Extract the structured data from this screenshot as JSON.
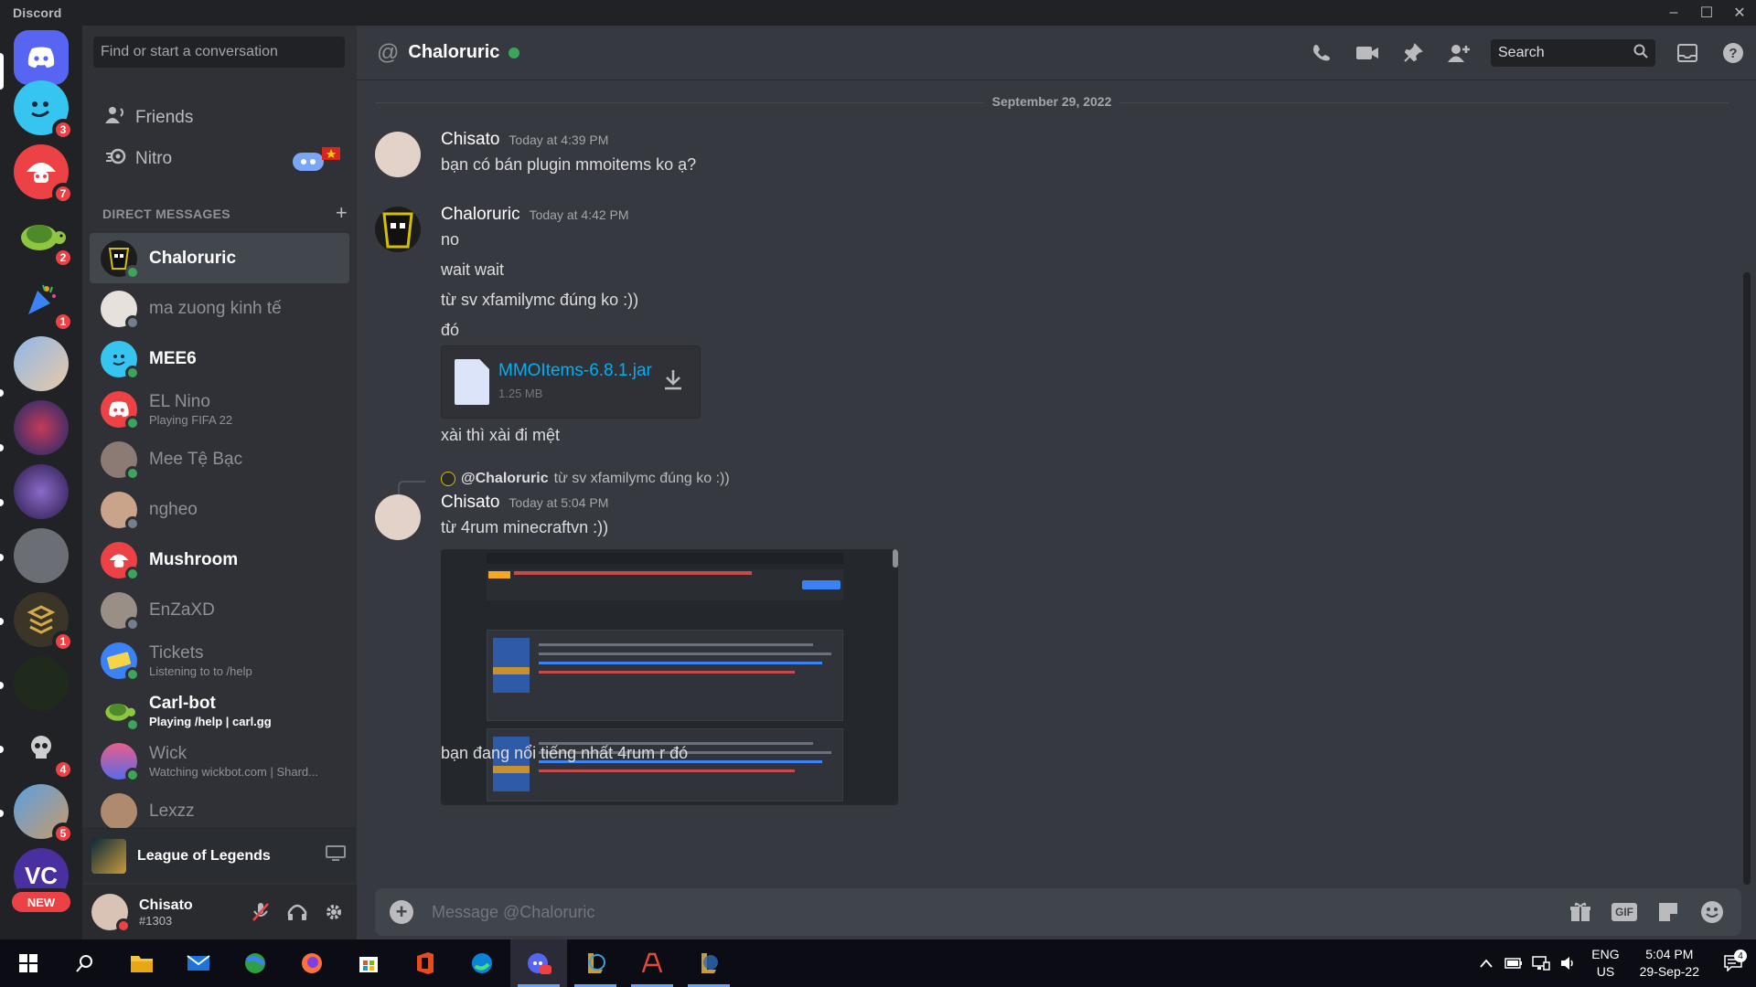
{
  "titlebar": {
    "brand": "Discord",
    "min": "–",
    "max": "☐",
    "close": "✕"
  },
  "servers": [
    {
      "name": "home",
      "badge": ""
    },
    {
      "name": "mee6-server",
      "badge": "3"
    },
    {
      "name": "mushroom-server",
      "badge": "7"
    },
    {
      "name": "turtle-server",
      "badge": "2"
    },
    {
      "name": "party-server",
      "badge": "1"
    },
    {
      "name": "anime-server",
      "badge": ""
    },
    {
      "name": "blue-server",
      "badge": ""
    },
    {
      "name": "purple-server",
      "badge": ""
    },
    {
      "name": "grey-server",
      "badge": ""
    },
    {
      "name": "gold-server",
      "badge": "1"
    },
    {
      "name": "dark-server",
      "badge": ""
    },
    {
      "name": "skull-server",
      "badge": "4"
    },
    {
      "name": "person-server",
      "badge": "5"
    },
    {
      "name": "vc-server",
      "badge": "NEW",
      "label": "VC"
    }
  ],
  "dm_panel": {
    "search_placeholder": "Find or start a conversation",
    "friends_label": "Friends",
    "nitro_label": "Nitro",
    "section_title": "DIRECT MESSAGES",
    "add_label": "+",
    "items": [
      {
        "name": "Chaloruric",
        "sub": "",
        "status": "online",
        "active": true
      },
      {
        "name": "ma zuong kinh tế",
        "sub": "",
        "status": "offline"
      },
      {
        "name": "MEE6",
        "sub": "",
        "status": "online"
      },
      {
        "name": "EL Nino",
        "sub": "Playing FIFA 22",
        "status": "online"
      },
      {
        "name": "Mee Tệ Bạc",
        "sub": "",
        "status": "online"
      },
      {
        "name": "ngheo",
        "sub": "",
        "status": "offline"
      },
      {
        "name": "Mushroom",
        "sub": "",
        "status": "online"
      },
      {
        "name": "EnZaXD",
        "sub": "",
        "status": "offline"
      },
      {
        "name": "Tickets",
        "sub": "Listening to to /help",
        "status": "online"
      },
      {
        "name": "Carl-bot",
        "sub": "Playing /help | carl.gg",
        "status": "online"
      },
      {
        "name": "Wick",
        "sub": "Watching wickbot.com | Shard...",
        "status": "online"
      },
      {
        "name": "Lexzz",
        "sub": "",
        "status": "online"
      }
    ]
  },
  "activity": {
    "game": "League of Legends"
  },
  "user": {
    "name": "Chisato",
    "tag": "#1303"
  },
  "chat": {
    "title": "Chaloruric",
    "at_symbol": "@",
    "search_placeholder": "Search",
    "date": "September 29, 2022",
    "messages": [
      {
        "author": "Chisato",
        "time": "Today at 4:39 PM",
        "lines": [
          "bạn có bán plugin mmoitems ko ạ?"
        ]
      },
      {
        "author": "Chaloruric",
        "time": "Today at 4:42 PM",
        "lines": [
          "no",
          "wait wait",
          "từ sv xfamilymc đúng ko :))",
          "đó"
        ]
      },
      {
        "author": "Chisato",
        "time": "Today at 5:04 PM",
        "lines": [
          "từ 4rum minecraftvn :))"
        ]
      }
    ],
    "attachment": {
      "name": "MMOItems-6.8.1.jar",
      "size": "1.25 MB"
    },
    "after_attachment": "xài thì xài đi mệt",
    "reply": {
      "mention": "@Chaloruric",
      "text": "từ sv xfamilymc đúng ko :))"
    },
    "final_line": "bạn đang nổi tiếng nhất 4rum r đó",
    "composer_placeholder": "Message @Chaloruric"
  },
  "taskbar": {
    "lang_top": "ENG",
    "lang_bottom": "US",
    "time": "5:04 PM",
    "date": "29-Sep-22",
    "notifications": "4"
  },
  "colors": {
    "blurple": "#5865f2",
    "online": "#3ba55c",
    "danger": "#ed4245",
    "link": "#00aff4"
  }
}
